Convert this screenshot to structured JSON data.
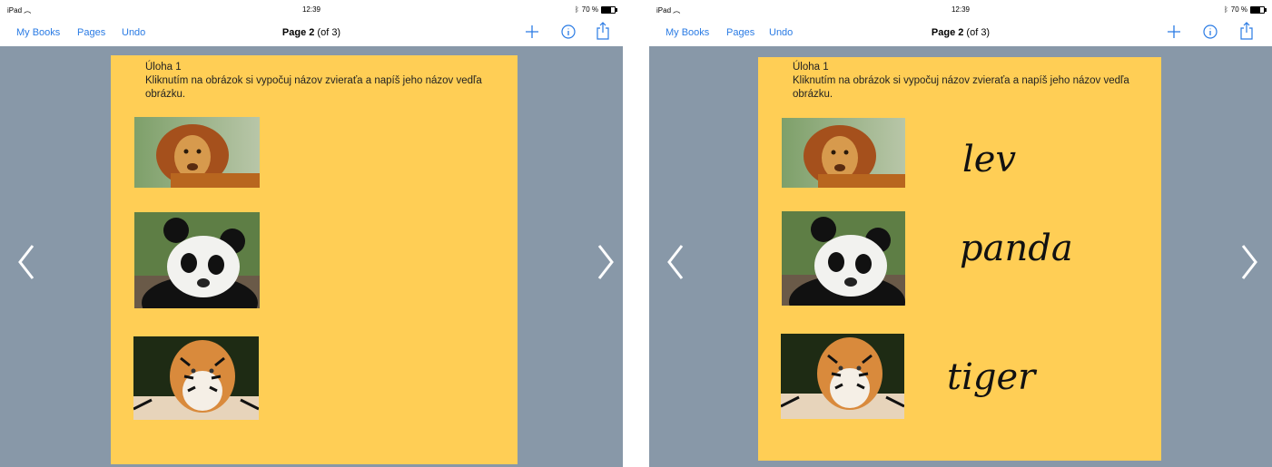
{
  "status": {
    "carrier": "iPad",
    "time": "12:39",
    "battery": "70 %"
  },
  "toolbar": {
    "my_books": "My Books",
    "pages": "Pages",
    "undo": "Undo",
    "page_bold": "Page 2",
    "page_rest": "(of 3)"
  },
  "task": {
    "heading": "Úloha 1",
    "text": "Kliknutím na obrázok si vypočuj názov zvieraťa a napíš jeho názov vedľa obrázku."
  },
  "animals": [
    "lion",
    "panda",
    "tiger"
  ],
  "answers": {
    "lion": "lev",
    "panda": "panda",
    "tiger": "tiger"
  },
  "colors": {
    "page": "#ffce55",
    "canvas": "#8898a8",
    "accent": "#2a7be4"
  }
}
